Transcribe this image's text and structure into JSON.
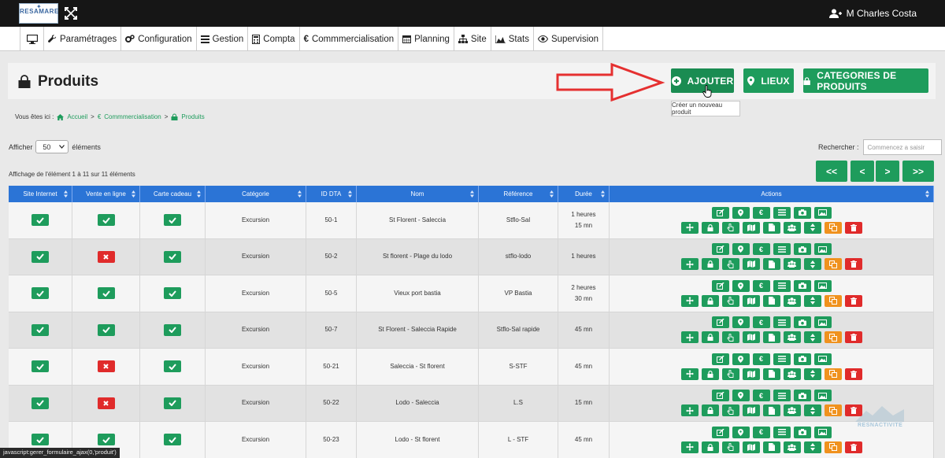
{
  "app": {
    "logo_text": "RESAMARE",
    "user_name": "M Charles Costa"
  },
  "menu": [
    {
      "label": "",
      "icon": "desktop-icon"
    },
    {
      "label": "Paramétrages",
      "icon": "wrench-icon"
    },
    {
      "label": "Configuration",
      "icon": "cogs-icon"
    },
    {
      "label": "Gestion",
      "icon": "list-icon"
    },
    {
      "label": "Compta",
      "icon": "calculator-icon"
    },
    {
      "label": "Commmercialisation",
      "icon": "euro-icon"
    },
    {
      "label": "Planning",
      "icon": "calendar-icon"
    },
    {
      "label": "Site",
      "icon": "sitemap-icon"
    },
    {
      "label": "Stats",
      "icon": "area-chart-icon"
    },
    {
      "label": "Supervision",
      "icon": "eye-icon"
    }
  ],
  "page": {
    "title": "Produits",
    "buttons": {
      "add": "AJOUTER",
      "places": "LIEUX",
      "categories": "CATEGORIES DE PRODUITS"
    },
    "tooltip": "Créer un nouveau produit"
  },
  "breadcrumb": {
    "prefix": "Vous êtes ici :",
    "items": [
      "Accueil",
      "Commmercialisation",
      "Produits"
    ],
    "separator": ">"
  },
  "list_controls": {
    "show_label": "Afficher",
    "page_size": "50",
    "show_suffix": "éléments",
    "search_label": "Rechercher :",
    "search_placeholder": "Commencez a saisir",
    "info": "Affichage de l'élément 1 à 11 sur 11 éléments",
    "pager": [
      "<<",
      "<",
      ">",
      ">>"
    ]
  },
  "table": {
    "headers": [
      "Site Internet",
      "Vente en ligne",
      "Carte cadeau",
      "Catégorie",
      "ID DTA",
      "Nom",
      "Référence",
      "Durée",
      "Actions"
    ],
    "rows": [
      {
        "site": true,
        "online": true,
        "gift": true,
        "category": "Excursion",
        "id": "50-1",
        "name": "St Florent - Saleccia",
        "ref": "Stflo-Sal",
        "dur1": "1 heures",
        "dur2": "15 mn"
      },
      {
        "site": true,
        "online": false,
        "gift": true,
        "category": "Excursion",
        "id": "50-2",
        "name": "St florent - Plage du lodo",
        "ref": "stflo-lodo",
        "dur1": "1 heures",
        "dur2": ""
      },
      {
        "site": true,
        "online": true,
        "gift": true,
        "category": "Excursion",
        "id": "50-5",
        "name": "Vieux port bastia",
        "ref": "VP Bastia",
        "dur1": "2 heures",
        "dur2": "30 mn"
      },
      {
        "site": true,
        "online": true,
        "gift": true,
        "category": "Excursion",
        "id": "50-7",
        "name": "St Florent - Saleccia Rapide",
        "ref": "Stflo-Sal rapide",
        "dur1": "45 mn",
        "dur2": ""
      },
      {
        "site": true,
        "online": false,
        "gift": true,
        "category": "Excursion",
        "id": "50-21",
        "name": "Saleccia - St florent",
        "ref": "S-STF",
        "dur1": "45 mn",
        "dur2": ""
      },
      {
        "site": true,
        "online": false,
        "gift": true,
        "category": "Excursion",
        "id": "50-22",
        "name": "Lodo - Saleccia",
        "ref": "L.S",
        "dur1": "15 mn",
        "dur2": ""
      },
      {
        "site": true,
        "online": true,
        "gift": true,
        "category": "Excursion",
        "id": "50-23",
        "name": "Lodo - St florent",
        "ref": "L - STF",
        "dur1": "45 mn",
        "dur2": ""
      }
    ],
    "action_icons_line1": [
      "edit-icon",
      "map-marker-icon",
      "euro-icon",
      "list-icon",
      "camera-icon",
      "image-icon"
    ],
    "action_icons_line2": [
      "move-icon",
      "lock-icon",
      "hand-pointer-icon",
      "map-icon",
      "file-icon",
      "users-icon",
      "sort-icon",
      "copy-icon",
      "trash-icon"
    ]
  },
  "statusbar": {
    "text": "javascript:gerer_formulaire_ajax(0,'produit')"
  },
  "watermark": {
    "text": "RESNACTIVITE"
  },
  "colors": {
    "green": "#1e9c5c",
    "red": "#e02b2b",
    "orange": "#f0921e",
    "blue_header": "#2b74d6",
    "topbar": "#161616"
  }
}
